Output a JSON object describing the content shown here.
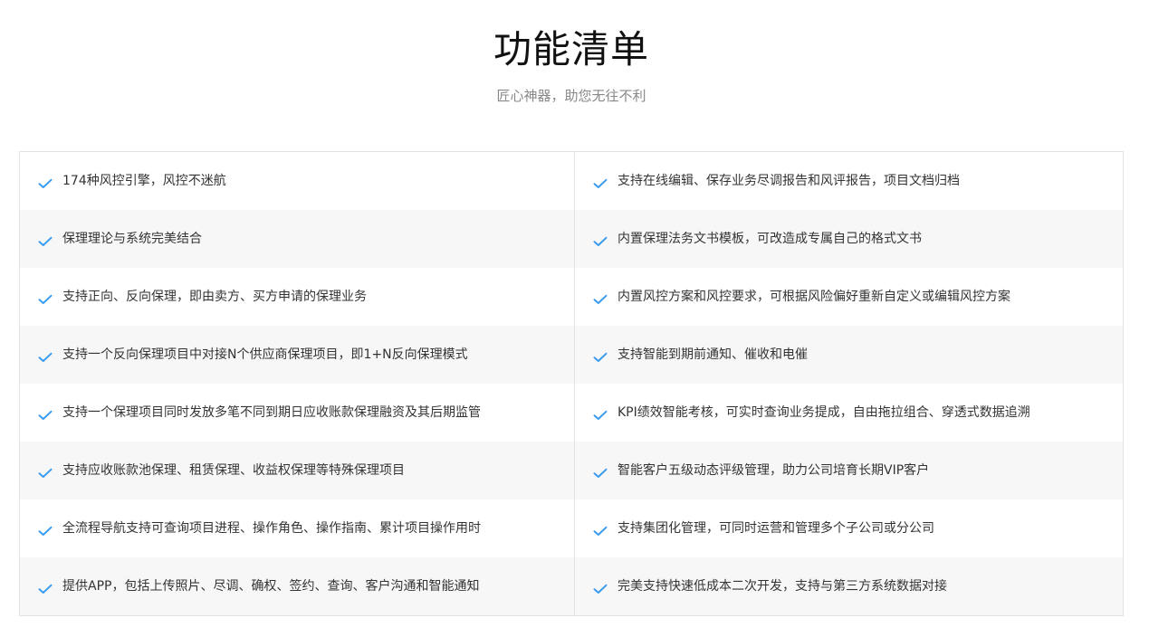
{
  "header": {
    "title": "功能清单",
    "subtitle": "匠心神器，助您无往不利"
  },
  "colors": {
    "check": "#3a9cf0",
    "alt_row_bg": "#f7f7f7",
    "border": "#e3e3e3"
  },
  "icons": {
    "bullet": "check-icon"
  },
  "rows": [
    {
      "left": "174种风控引擎，风控不迷航",
      "right": "支持在线编辑、保存业务尽调报告和风评报告，项目文档归档"
    },
    {
      "left": "保理理论与系统完美结合",
      "right": "内置保理法务文书模板，可改造成专属自己的格式文书"
    },
    {
      "left": "支持正向、反向保理，即由卖方、买方申请的保理业务",
      "right": "内置风控方案和风控要求，可根据风险偏好重新自定义或编辑风控方案"
    },
    {
      "left": "支持一个反向保理项目中对接N个供应商保理项目，即1+N反向保理模式",
      "right": "支持智能到期前通知、催收和电催"
    },
    {
      "left": "支持一个保理项目同时发放多笔不同到期日应收账款保理融资及其后期监管",
      "right": "KPI绩效智能考核，可实时查询业务提成，自由拖拉组合、穿透式数据追溯"
    },
    {
      "left": "支持应收账款池保理、租赁保理、收益权保理等特殊保理项目",
      "right": "智能客户五级动态评级管理，助力公司培育长期VIP客户"
    },
    {
      "left": "全流程导航支持可查询项目进程、操作角色、操作指南、累计项目操作用时",
      "right": "支持集团化管理，可同时运营和管理多个子公司或分公司"
    },
    {
      "left": "提供APP，包括上传照片、尽调、确权、签约、查询、客户沟通和智能通知",
      "right": "完美支持快速低成本二次开发，支持与第三方系统数据对接"
    }
  ]
}
